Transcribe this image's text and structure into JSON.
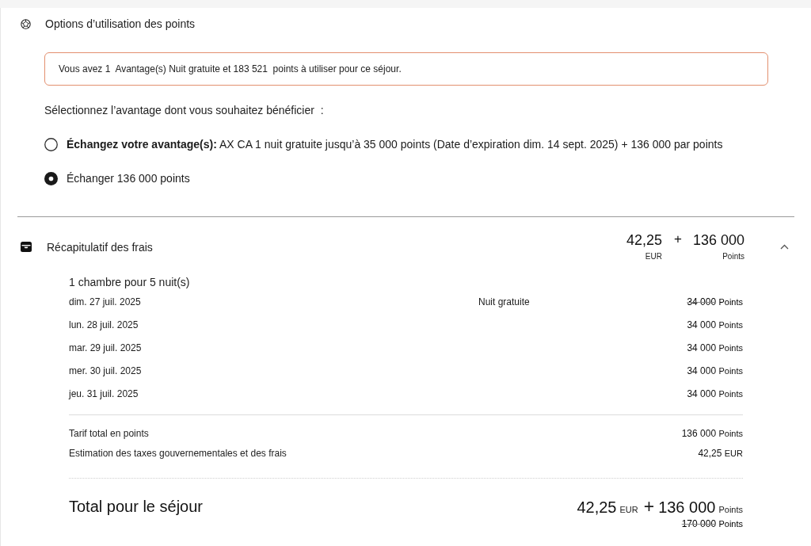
{
  "points_options": {
    "title": "Options d’utilisation des points",
    "notice": "Vous avez 1  Avantage(s) Nuit gratuite et 183 521  points à utiliser pour ce séjour.",
    "prompt": "Sélectionnez l’avantage dont vous souhaitez bénéficier  :",
    "options": [
      {
        "label": "**Échangez votre avantage(s):** AX CA 1 nuit gratuite jusqu’à 35 000 points (Date d’expiration dim. 14 sept. 2025) + 136 000 par points",
        "selected": false
      },
      {
        "label": "Échanger 136 000 points",
        "selected": true
      }
    ]
  },
  "fees_summary": {
    "title": "Récapitulatif des frais",
    "expanded": true,
    "amount": "42,25",
    "amount_unit": "EUR",
    "plus": "+",
    "points": "136 000",
    "points_unit": "Points",
    "room_summary": "1 chambre pour 5 nuit(s)",
    "nights": [
      {
        "date": "dim. 27 juil. 2025",
        "note": "Nuit gratuite",
        "points": "34 000",
        "unit": "Points",
        "struck": true
      },
      {
        "date": "lun. 28 juil. 2025",
        "points": "34 000",
        "unit": "Points",
        "struck": false
      },
      {
        "date": "mar. 29 juil. 2025",
        "points": "34 000",
        "unit": "Points",
        "struck": false
      },
      {
        "date": "mer. 30 juil. 2025",
        "points": "34 000",
        "unit": "Points",
        "struck": false
      },
      {
        "date": "jeu. 31 juil. 2025",
        "points": "34 000",
        "unit": "Points",
        "struck": false
      }
    ],
    "subtotals": [
      {
        "label": "Tarif total en points",
        "value": "136 000",
        "unit": "Points"
      },
      {
        "label": "Estimation des taxes gouvernementales et des frais",
        "value": "42,25",
        "unit": "EUR"
      }
    ],
    "total": {
      "label": "Total pour le séjour",
      "amount": "42,25",
      "amount_unit": "EUR",
      "plus": "+",
      "points": "136 000",
      "points_unit": "Points",
      "original_points": "170 000",
      "original_unit": "Points"
    }
  }
}
